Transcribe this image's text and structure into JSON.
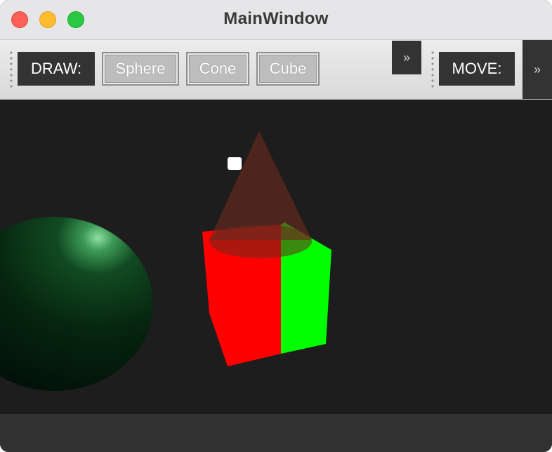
{
  "window": {
    "title": "MainWindow"
  },
  "toolbar_draw": {
    "label": "DRAW:",
    "buttons": [
      "Sphere",
      "Cone",
      "Cube"
    ],
    "overflow": "»"
  },
  "toolbar_move": {
    "label": "MOVE:",
    "overflow": "»"
  },
  "scene": {
    "background": "#1d1d1d",
    "objects": [
      {
        "type": "sphere",
        "color": "#0b4a1c"
      },
      {
        "type": "cube",
        "front_color": "#ff0000",
        "side_color": "#00ff00"
      },
      {
        "type": "cone",
        "color": "#5a2a1f"
      }
    ]
  }
}
